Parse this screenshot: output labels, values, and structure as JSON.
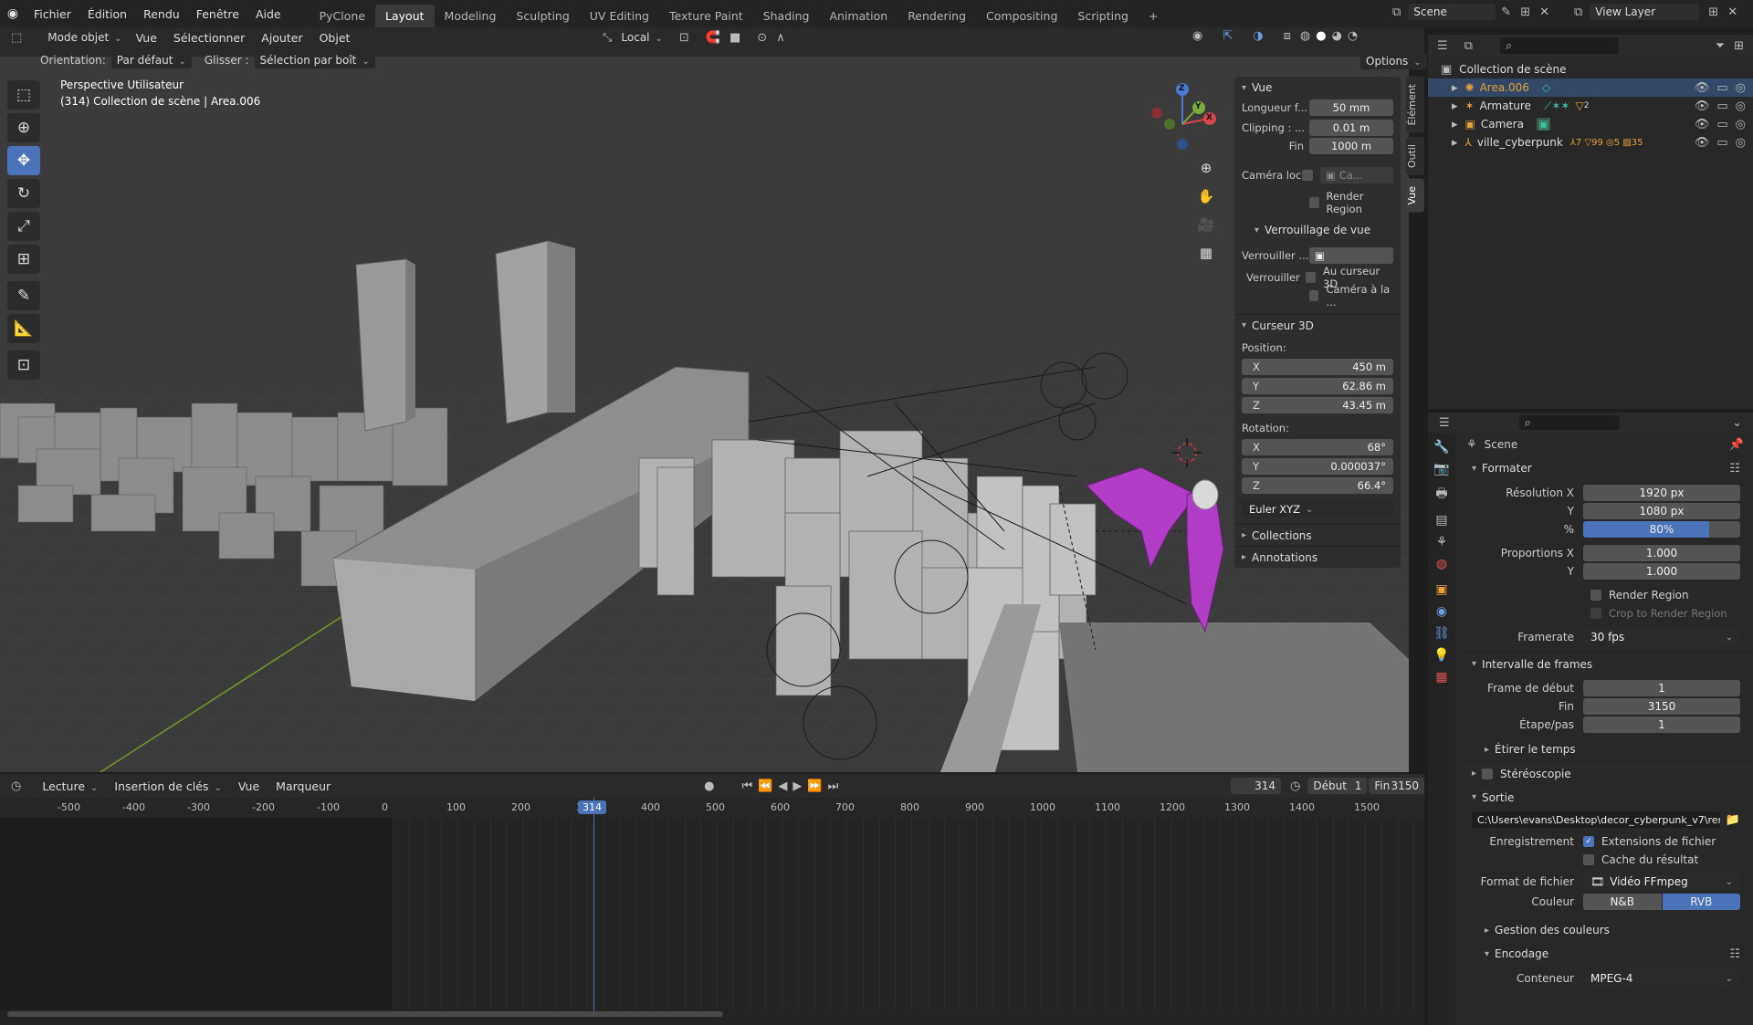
{
  "menus": [
    "Fichier",
    "Édition",
    "Rendu",
    "Fenêtre",
    "Aide"
  ],
  "workspaces": [
    "PyClone",
    "Layout",
    "Modeling",
    "Sculpting",
    "UV Editing",
    "Texture Paint",
    "Shading",
    "Animation",
    "Rendering",
    "Compositing",
    "Scripting"
  ],
  "scene_name": "Scene",
  "view_layer": "View Layer",
  "viewport_header": {
    "mode": "Mode objet",
    "menu": [
      "Vue",
      "Sélectionner",
      "Ajouter",
      "Objet"
    ],
    "transform_orientation": "Local"
  },
  "tool_settings": {
    "orientation_label": "Orientation:",
    "orientation_value": "Par défaut",
    "drag_label": "Glisser :",
    "drag_value": "Sélection par boît",
    "options": "Options"
  },
  "viewport_info": {
    "line1": "Perspective Utilisateur",
    "line2": "(314) Collection de scène | Area.006"
  },
  "gizmo": {
    "x": "X",
    "y": "Y",
    "z": "Z"
  },
  "npanel": {
    "tabs": [
      "Élément",
      "Outil",
      "Vue"
    ],
    "view_section": "Vue",
    "focal_label": "Longueur f...",
    "focal_value": "50 mm",
    "clip_label": "Clipping : ...",
    "clip_start": "0.01 m",
    "clip_end_label": "Fin",
    "clip_end": "1000 m",
    "camera_label": "Caméra loc",
    "camera_value": "Ca...",
    "render_region": "Render Region",
    "lock_section": "Verrouillage de vue",
    "lock_label1": "Verrouiller ...",
    "lock_label2": "Verrouiller",
    "lock_cursor": "Au curseur 3D",
    "lock_camera": "Caméra à la ...",
    "cursor_section": "Curseur 3D",
    "position_label": "Position:",
    "pos_x": "450 m",
    "pos_y": "62.86 m",
    "pos_z": "43.45 m",
    "rotation_label": "Rotation:",
    "rot_x": "68°",
    "rot_y": "0.000037°",
    "rot_z": "66.4°",
    "rot_mode": "Euler XYZ",
    "collections": "Collections",
    "annotations": "Annotations"
  },
  "outliner": {
    "root": "Collection de scène",
    "items": [
      {
        "name": "Area.006",
        "selected": true
      },
      {
        "name": "Armature",
        "selected": false
      },
      {
        "name": "Camera",
        "selected": false
      },
      {
        "name": "ville_cyberpunk",
        "selected": false
      }
    ],
    "badges": {
      "armature": "2",
      "ville1": "7",
      "ville2": "99",
      "ville3": "5",
      "ville4": "35"
    }
  },
  "properties": {
    "context": "Scene",
    "format_section": "Formater",
    "res_x_label": "Résolution X",
    "res_x": "1920 px",
    "res_y_label": "Y",
    "res_y": "1080 px",
    "res_pct_label": "%",
    "res_pct": "80%",
    "res_pct_fraction": 0.8,
    "aspect_x_label": "Proportions X",
    "aspect_x": "1.000",
    "aspect_y_label": "Y",
    "aspect_y": "1.000",
    "render_region": "Render Region",
    "crop_region": "Crop to Render Region",
    "framerate_label": "Framerate",
    "framerate": "30 fps",
    "frame_range_section": "Intervalle de frames",
    "frame_start_label": "Frame de début",
    "frame_start": "1",
    "frame_end_label": "Fin",
    "frame_end": "3150",
    "frame_step_label": "Étape/pas",
    "frame_step": "1",
    "time_stretch": "Étirer le temps",
    "stereoscopy": "Stéréoscopie",
    "output_section": "Sortie",
    "output_path": "C:\\Users\\evans\\Desktop\\decor_cyberpunk_v7\\rendu\\",
    "saving_label": "Enregistrement",
    "file_ext": "Extensions de fichier",
    "cache_result": "Cache du résultat",
    "file_format_label": "Format de fichier",
    "file_format": "Vidéo FFmpeg",
    "color_label": "Couleur",
    "color_bw": "N&B",
    "color_rgb": "RVB",
    "color_management": "Gestion des couleurs",
    "encoding_section": "Encodage",
    "container_label": "Conteneur",
    "container": "MPEG-4"
  },
  "timeline": {
    "menus": [
      "Lecture",
      "Insertion de clés",
      "Vue",
      "Marqueur"
    ],
    "current_frame": "314",
    "start_label": "Début",
    "start": "1",
    "end_label": "Fin",
    "end": "3150",
    "ruler": [
      "-500",
      "-400",
      "-300",
      "-200",
      "-100",
      "0",
      "100",
      "200",
      "300",
      "400",
      "500",
      "600",
      "700",
      "800",
      "900",
      "1000",
      "1100",
      "1200",
      "1300",
      "1400",
      "1500"
    ],
    "playhead": "314"
  },
  "colors": {
    "accent": "#4a73b9",
    "selected_object": "#e8a13a",
    "character": "#b13cc6"
  }
}
